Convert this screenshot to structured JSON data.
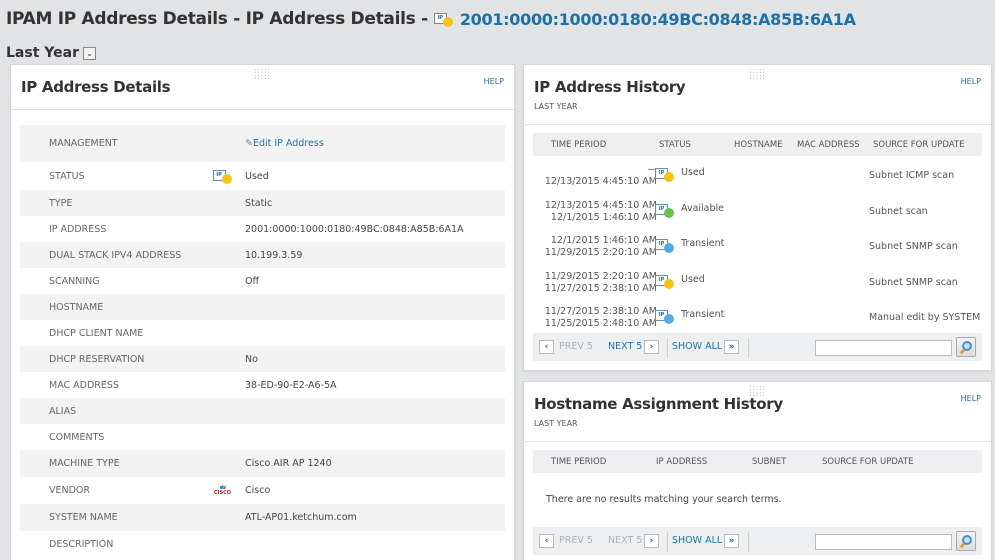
{
  "header": {
    "title": "IPAM IP Address Details - IP Address Details -",
    "ip_address": "2001:0000:1000:0180:49BC:0848:A85B:6A1A",
    "status_icon": "ip-status-used-icon",
    "time_period": "Last Year",
    "dropdown_icon": "chevron-down-icon"
  },
  "colors": {
    "accent": "#1e72a3",
    "used": "#f5c417",
    "available": "#6bbf4e",
    "transient": "#5aa9e0",
    "background": "#e2e3e4"
  },
  "details_panel": {
    "title": "IP Address Details",
    "help": "HELP",
    "rows": [
      {
        "label": "MANAGEMENT",
        "value": "Edit IP Address",
        "icon": "pencil-icon",
        "link": true
      },
      {
        "label": "STATUS",
        "value": "Used",
        "icon": "ip-status-used-icon"
      },
      {
        "label": "TYPE",
        "value": "Static"
      },
      {
        "label": "IP ADDRESS",
        "value": "2001:0000:1000:0180:49BC:0848:A85B:6A1A"
      },
      {
        "label": "DUAL STACK IPV4 ADDRESS",
        "value": "10.199.3.59"
      },
      {
        "label": "SCANNING",
        "value": "Off"
      },
      {
        "label": "HOSTNAME",
        "value": ""
      },
      {
        "label": "DHCP CLIENT NAME",
        "value": ""
      },
      {
        "label": "DHCP RESERVATION",
        "value": "No"
      },
      {
        "label": "MAC ADDRESS",
        "value": "38-ED-90-E2-A6-5A"
      },
      {
        "label": "ALIAS",
        "value": ""
      },
      {
        "label": "COMMENTS",
        "value": ""
      },
      {
        "label": "MACHINE TYPE",
        "value": "Cisco AIR AP 1240"
      },
      {
        "label": "VENDOR",
        "value": "Cisco",
        "icon": "cisco-logo-icon"
      },
      {
        "label": "SYSTEM NAME",
        "value": "ATL-AP01.ketchum.com"
      },
      {
        "label": "DESCRIPTION",
        "value": ""
      }
    ]
  },
  "history_panel": {
    "title": "IP Address History",
    "subtitle": "LAST YEAR",
    "help": "HELP",
    "columns": [
      "TIME PERIOD",
      "STATUS",
      "HOSTNAME",
      "MAC ADDRESS",
      "SOURCE FOR UPDATE"
    ],
    "rows": [
      {
        "from": "—",
        "to": "12/13/2015 4:45:10 AM",
        "status": "Used",
        "status_color": "#f5c417",
        "hostname": "",
        "mac": "",
        "source": "Subnet ICMP scan"
      },
      {
        "from": "12/13/2015 4:45:10 AM",
        "to": "12/1/2015 1:46:10 AM",
        "status": "Available",
        "status_color": "#6bbf4e",
        "hostname": "",
        "mac": "",
        "source": "Subnet scan"
      },
      {
        "from": "12/1/2015 1:46:10 AM",
        "to": "11/29/2015 2:20:10 AM",
        "status": "Transient",
        "status_color": "#5aa9e0",
        "hostname": "",
        "mac": "",
        "source": "Subnet SNMP scan"
      },
      {
        "from": "11/29/2015 2:20:10 AM",
        "to": "11/27/2015 2:38:10 AM",
        "status": "Used",
        "status_color": "#f5c417",
        "hostname": "",
        "mac": "",
        "source": "Subnet SNMP scan"
      },
      {
        "from": "11/27/2015 2:38:10 AM",
        "to": "11/25/2015 2:48:10 AM",
        "status": "Transient",
        "status_color": "#5aa9e0",
        "hostname": "",
        "mac": "",
        "source": "Manual edit by SYSTEM"
      }
    ],
    "pager": {
      "prev": "PREV 5",
      "next": "NEXT 5",
      "show_all": "SHOW ALL",
      "prev_enabled": false,
      "next_enabled": true,
      "search_value": ""
    }
  },
  "hostname_panel": {
    "title": "Hostname Assignment History",
    "subtitle": "LAST YEAR",
    "help": "HELP",
    "columns": [
      "TIME PERIOD",
      "IP ADDRESS",
      "SUBNET",
      "SOURCE FOR UPDATE"
    ],
    "empty_message": "There are no results matching your search terms.",
    "pager": {
      "prev": "PREV 5",
      "next": "NEXT 5",
      "show_all": "SHOW ALL",
      "prev_enabled": false,
      "next_enabled": false,
      "search_value": ""
    }
  }
}
